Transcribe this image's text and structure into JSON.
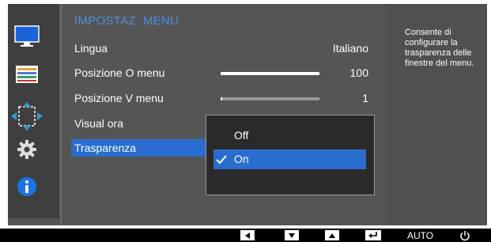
{
  "menu": {
    "title": "IMPOSTAZ. MENU",
    "items": [
      {
        "label": "Lingua",
        "value": "Italiano"
      },
      {
        "label": "Posizione O menu",
        "value": "100",
        "level": 1.0
      },
      {
        "label": "Posizione V menu",
        "value": "1",
        "level": 0.01
      },
      {
        "label": "Visual ora",
        "value": ""
      },
      {
        "label": "Trasparenza",
        "value": ""
      }
    ],
    "selected_item": "Trasparenza"
  },
  "dropdown": {
    "options": [
      {
        "label": "Off",
        "selected": false
      },
      {
        "label": "On",
        "selected": true
      }
    ]
  },
  "help": {
    "text": "Consente di configurare la trasparenza delle finestre del menu."
  },
  "sidebar": {
    "icons": [
      "monitor-icon",
      "color-bars-icon",
      "resize-arrows-icon",
      "gear-icon",
      "info-icon"
    ],
    "active_icon": "resize-arrows-icon"
  },
  "bottom_bar": {
    "buttons": [
      "left-arrow-icon",
      "down-arrow-icon",
      "up-arrow-icon",
      "enter-icon",
      "AUTO",
      "power-icon"
    ]
  },
  "colors": {
    "accent": "#2a6dd0",
    "title": "#4a8ee0",
    "background": "#555555"
  }
}
